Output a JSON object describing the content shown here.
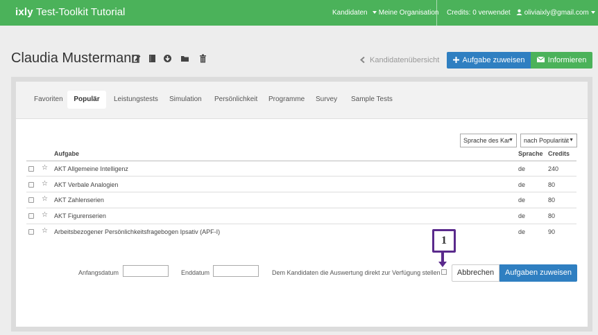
{
  "topbar": {
    "brand": "ixly",
    "title": "Test-Toolkit Tutorial",
    "nav": {
      "kandidaten": "Kandidaten",
      "organisation": "Meine Organisation",
      "credits": "Credits: 0 verwendet",
      "user": "oliviaixly@gmail.com"
    },
    "color": "#4bb25a"
  },
  "header": {
    "candidate_name": "Claudia Mustermann",
    "icons": [
      "edit-icon",
      "book-icon",
      "download-icon",
      "folder-icon",
      "trash-icon"
    ],
    "back_link": "Kandidatenübersicht",
    "assign_button": "Aufgabe zuweisen",
    "inform_button": "Informieren"
  },
  "tabs": {
    "items": [
      {
        "label": "Favoriten"
      },
      {
        "label": "Populär",
        "active": true
      },
      {
        "label": "Leistungstests"
      },
      {
        "label": "Simulation"
      },
      {
        "label": "Persönlichkeit"
      },
      {
        "label": "Programme"
      },
      {
        "label": "Survey"
      },
      {
        "label": "Sample Tests"
      }
    ]
  },
  "filters": {
    "language": "Sprache des Kar",
    "sort": "nach Popularität"
  },
  "table": {
    "columns": {
      "task": "Aufgabe",
      "language": "Sprache",
      "credits": "Credits"
    },
    "rows": [
      {
        "name": "AKT Allgemeine Intelligenz",
        "language": "de",
        "credits": "240"
      },
      {
        "name": "AKT Verbale Analogien",
        "language": "de",
        "credits": "80"
      },
      {
        "name": "AKT Zahlenserien",
        "language": "de",
        "credits": "80"
      },
      {
        "name": "AKT Figurenserien",
        "language": "de",
        "credits": "80"
      },
      {
        "name": "Arbeitsbezogener Persönlichkeitsfragebogen Ipsativ (APF-I)",
        "language": "de",
        "credits": "90"
      }
    ]
  },
  "footer": {
    "start_date_label": "Anfangsdatum",
    "end_date_label": "Enddatum",
    "direct_result_label": "Dem Kandidaten die Auswertung direkt zur Verfügung stellen",
    "cancel_button": "Abbrechen",
    "assign_tasks_button": "Aufgaben zuweisen"
  },
  "callout": {
    "number": "1",
    "color": "#5a2a8c"
  },
  "colors": {
    "primary_blue": "#2f7fc1",
    "green": "#4bb25a"
  }
}
